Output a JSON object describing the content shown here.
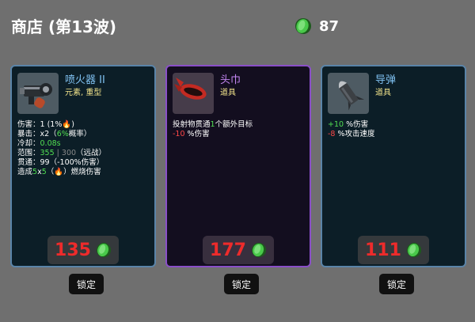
{
  "header": {
    "title": "商店 (第13波)",
    "coins": "87"
  },
  "items": [
    {
      "name": "喷火器 II",
      "type": "元素, 重型",
      "icon": "flamethrower-icon",
      "stats": [
        {
          "label": "伤害",
          "parts": [
            {
              "t": "1 (1%"
            },
            {
              "t": "🔥",
              "c": "o"
            },
            {
              "t": ")"
            }
          ]
        },
        {
          "label": "暴击",
          "parts": [
            {
              "t": "x2（"
            },
            {
              "t": "6%",
              "c": "g"
            },
            {
              "t": "概率）"
            }
          ]
        },
        {
          "label": "冷却",
          "parts": [
            {
              "t": "0.08s",
              "c": "g"
            }
          ]
        },
        {
          "label": "范围",
          "parts": [
            {
              "t": "355",
              "c": "g"
            },
            {
              "t": " | 300",
              "c": "dim"
            },
            {
              "t": "（远战）"
            }
          ]
        },
        {
          "label": "贯通",
          "parts": [
            {
              "t": "99（-100%伤害）"
            }
          ]
        },
        {
          "label": "",
          "parts": [
            {
              "t": "造成"
            },
            {
              "t": "5",
              "c": "g"
            },
            {
              "t": "x"
            },
            {
              "t": "5",
              "c": "g"
            },
            {
              "t": "（"
            },
            {
              "t": "🔥",
              "c": "o"
            },
            {
              "t": "）燃烧伤害"
            }
          ]
        }
      ],
      "price": "135",
      "lock_label": "锁定",
      "rarity": "common"
    },
    {
      "name": "头巾",
      "type": "道具",
      "icon": "headband-icon",
      "stats": [
        {
          "label": "",
          "parts": [
            {
              "t": "投射物贯通"
            },
            {
              "t": "1",
              "c": "g"
            },
            {
              "t": "个额外目标"
            }
          ]
        },
        {
          "label": "",
          "parts": [
            {
              "t": "-10",
              "c": "r"
            },
            {
              "t": " %伤害"
            }
          ]
        }
      ],
      "price": "177",
      "lock_label": "锁定",
      "rarity": "rare"
    },
    {
      "name": "导弹",
      "type": "道具",
      "icon": "missile-icon",
      "stats": [
        {
          "label": "",
          "parts": [
            {
              "t": "+10",
              "c": "g"
            },
            {
              "t": " %伤害"
            }
          ]
        },
        {
          "label": "",
          "parts": [
            {
              "t": "-8",
              "c": "r"
            },
            {
              "t": " %攻击速度"
            }
          ]
        }
      ],
      "price": "111",
      "lock_label": "锁定",
      "rarity": "common"
    }
  ],
  "colors": {
    "border_common": "#5a84a8",
    "border_rare": "#8a4fc8",
    "price_red": "#ee2b2b",
    "coin_green": "#3fbf3f"
  }
}
